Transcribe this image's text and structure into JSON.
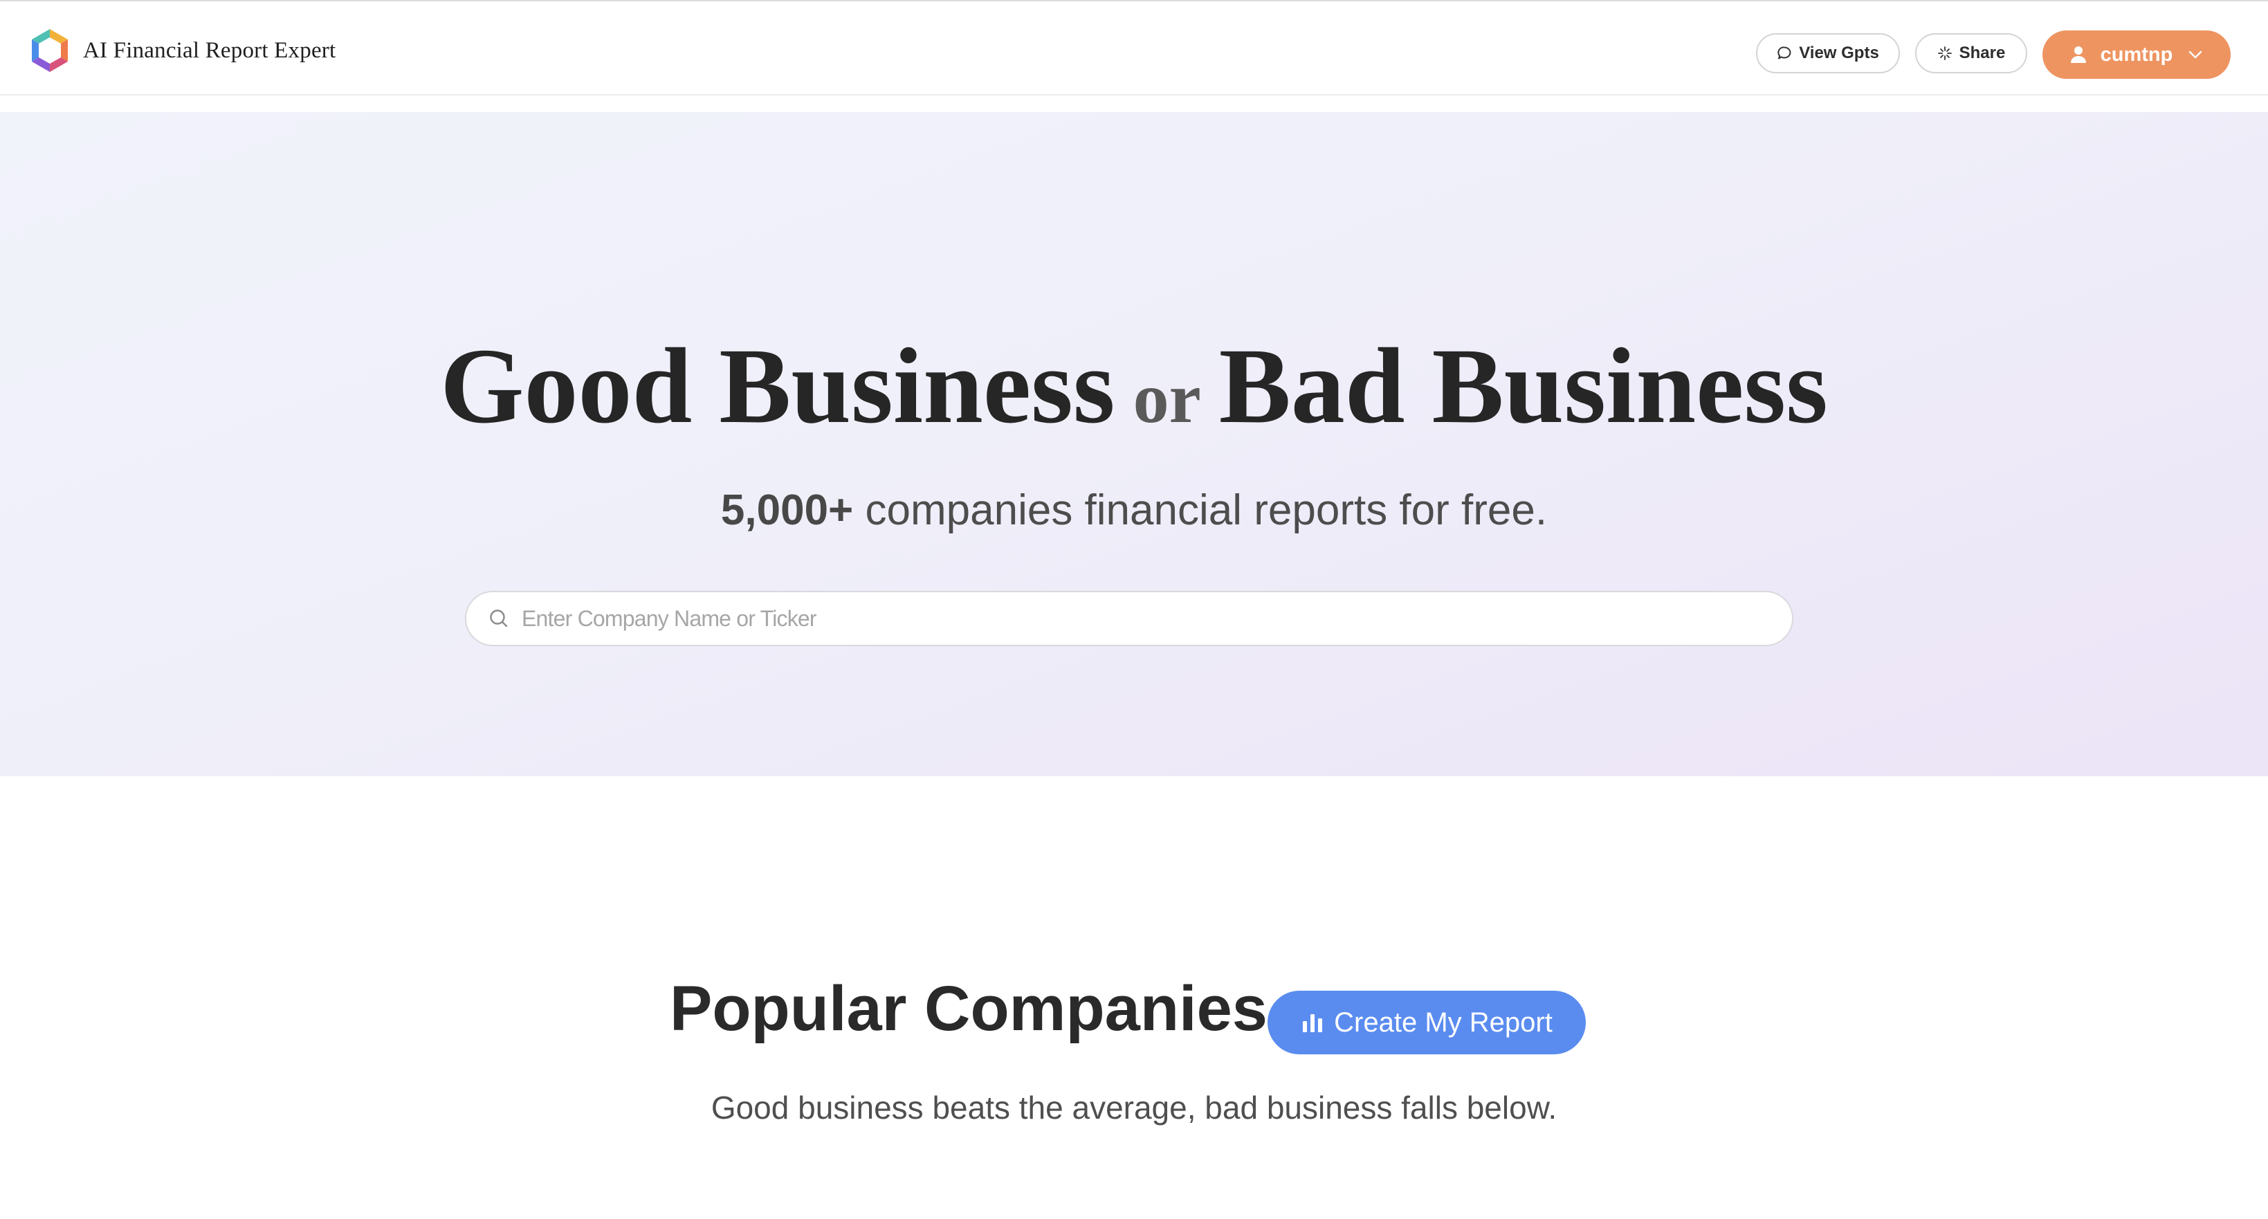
{
  "header": {
    "brand_name": "AI Financial Report Expert",
    "view_gpts_label": "View Gpts",
    "share_label": "Share",
    "user_name": "cumtnp"
  },
  "hero": {
    "title_part1": "Good Business",
    "title_or": "or",
    "title_part2": "Bad Business",
    "subtitle_bold": "5,000+",
    "subtitle_rest": " companies financial reports for free.",
    "search_placeholder": "Enter Company Name or Ticker"
  },
  "popular": {
    "title": "Popular Companies",
    "create_button_label": "Create My Report",
    "subtitle": "Good business beats the average, bad business falls below."
  },
  "icons": {
    "logo": "hexagon-logo-icon",
    "view_gpts": "chat-bubble-icon",
    "share": "sparkle-icon",
    "user": "user-icon",
    "user_menu": "chevron-down-icon",
    "search": "search-icon",
    "create_report": "bar-chart-icon"
  },
  "colors": {
    "user_button": "#ee9460",
    "create_button": "#5a8cf0",
    "hero_gradient_start": "#f1f3fb",
    "hero_gradient_end": "#ece4f7"
  }
}
